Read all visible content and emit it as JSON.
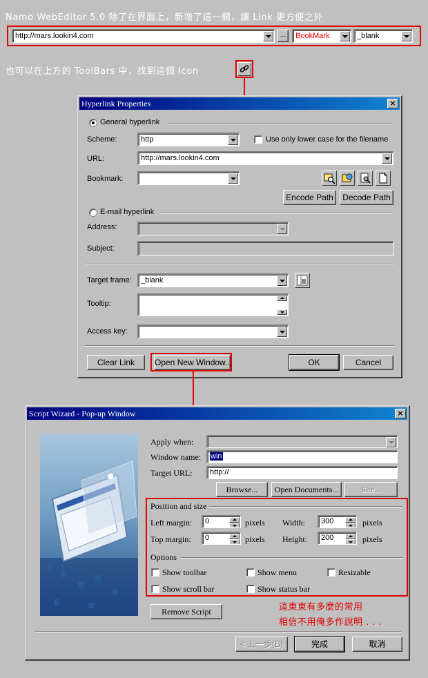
{
  "top_caption": "Namo WebEditor 5.0 除了在界面上，新增了這一欄，讓 Link 更方便之外",
  "toolbar": {
    "url_value": "http://mars.lookin4.com",
    "more_label": "...",
    "bookmark_label": "BookMark",
    "target_value": "_blank"
  },
  "second_caption": "也可以在上方的 ToolBars 中，找到這個 Icon",
  "hyperlink_dialog": {
    "title": "Hyperlink Properties",
    "close_label": "×",
    "general_hyperlink_label": "General hyperlink",
    "scheme_label": "Scheme:",
    "scheme_value": "http",
    "lowercase_label": "Use only lower case for the filename",
    "url_label": "URL:",
    "url_value": "http://mars.lookin4.com",
    "bookmark_label": "Bookmark:",
    "bookmark_value": "",
    "encode_path_label": "Encode Path",
    "decode_path_label": "Decode Path",
    "email_hyperlink_label": "E-mail hyperlink",
    "address_label": "Address:",
    "subject_label": "Subject:",
    "target_frame_label": "Target frame:",
    "target_frame_value": "_blank",
    "tooltip_label": "Tooltip:",
    "access_key_label": "Access key:",
    "clear_link_label": "Clear Link",
    "open_new_window_label": "Open New Window...",
    "ok_label": "OK",
    "cancel_label": "Cancel"
  },
  "script_wizard": {
    "title": "Script Wizard - Pop-up Window",
    "close_label": "×",
    "apply_when_label": "Apply when:",
    "window_name_label": "Window name:",
    "window_name_value": "win",
    "target_url_label": "Target URL:",
    "target_url_value": "http://",
    "browse_label": "Browse...",
    "open_documents_label": "Open Documents...",
    "site_label": "Site...",
    "position_size_label": "Position and size",
    "left_margin_label": "Left margin:",
    "left_margin_value": "0",
    "top_margin_label": "Top margin:",
    "top_margin_value": "0",
    "pixels_label": "pixels",
    "width_label": "Width:",
    "width_value": "300",
    "height_label": "Height:",
    "height_value": "200",
    "options_label": "Options",
    "show_toolbar_label": "Show toolbar",
    "show_menu_label": "Show menu",
    "resizable_label": "Resizable",
    "show_scroll_bar_label": "Show scroll bar",
    "show_status_bar_label": "Show status bar",
    "remove_script_label": "Remove Script",
    "back_label": "< 上一步(B)",
    "finish_label": "完成",
    "cancel_label": "取消"
  },
  "note": {
    "line1": "這東東有多麼的常用",
    "line2": "相信不用俺多作說明 . . ."
  },
  "colors": {
    "highlight_red": "#e00000",
    "title_blue": "#000080",
    "bookmark_red": "#e00000"
  }
}
